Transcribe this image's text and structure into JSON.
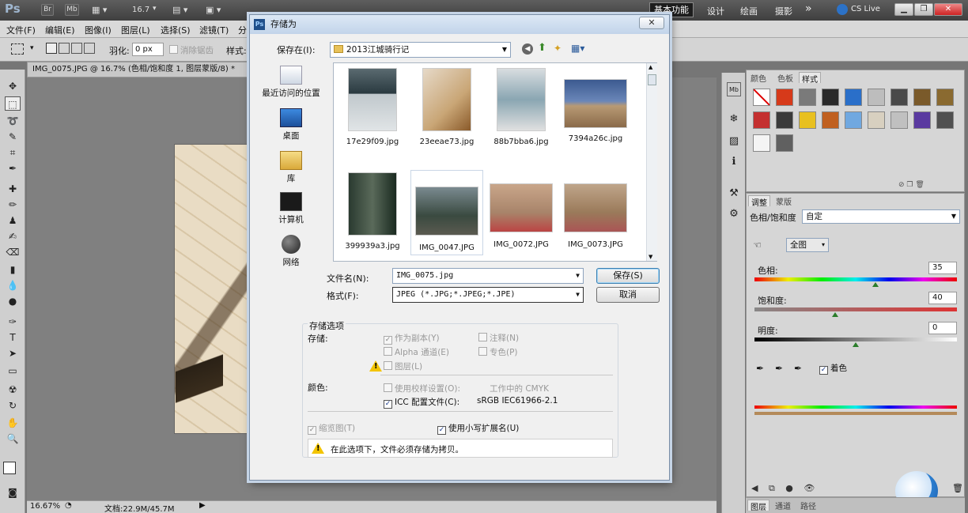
{
  "appbar": {
    "logo": "Ps",
    "br": "Br",
    "mb": "Mb",
    "zoom": "16.7",
    "workspaces": [
      "基本功能",
      "设计",
      "绘画",
      "摄影"
    ],
    "more": "»",
    "cslive": "CS Live"
  },
  "menubar": [
    "文件(F)",
    "编辑(E)",
    "图像(I)",
    "图层(L)",
    "选择(S)",
    "滤镜(T)",
    "分"
  ],
  "options": {
    "feather_label": "羽化:",
    "feather_value": "0 px",
    "antialias": "消除锯齿",
    "style_label": "样式:"
  },
  "document": {
    "tab": "IMG_0075.JPG @ 16.7% (色相/饱和度 1, 图层蒙版/8) *",
    "zoom": "16.67%",
    "docsize": "文档:22.9M/45.7M"
  },
  "styles_panel": {
    "tabs": [
      "颜色",
      "色板",
      "样式"
    ],
    "colors": [
      "#ffffff",
      "#d63a1a",
      "#7a7a7a",
      "#2a2a2a",
      "#2a6fc9",
      "#bdbdbd",
      "#4a4a4a",
      "#7a5a2a",
      "#8a6a30",
      "#c43030",
      "#3a3a3a",
      "#e8c020",
      "#c06020",
      "#70a8e0",
      "#d8d0c0",
      "#c0c0c0",
      "#5a3aa0",
      "#505050",
      "#f4f4f4",
      "#606060"
    ]
  },
  "adjust_panel": {
    "tabs": [
      "调整",
      "蒙版"
    ],
    "preset_label": "色相/饱和度",
    "preset_value": "自定",
    "range": "全图",
    "hue_label": "色相:",
    "hue_value": "35",
    "sat_label": "饱和度:",
    "sat_value": "40",
    "light_label": "明度:",
    "light_value": "0",
    "colorize": "着色"
  },
  "layers_tabs": [
    "图层",
    "通道",
    "路径"
  ],
  "dialog": {
    "title": "存储为",
    "savein_label": "保存在(I):",
    "savein_value": "2013江城骑行记",
    "places": [
      "最近访问的位置",
      "桌面",
      "库",
      "计算机",
      "网络"
    ],
    "files": [
      {
        "name": "17e29f09.jpg"
      },
      {
        "name": "23eeae73.jpg"
      },
      {
        "name": "88b7bba6.jpg"
      },
      {
        "name": "7394a26c.jpg"
      },
      {
        "name": "399939a3.jpg"
      },
      {
        "name": "IMG_0047.JPG"
      },
      {
        "name": "IMG_0072.JPG"
      },
      {
        "name": "IMG_0073.JPG"
      }
    ],
    "filename_label": "文件名(N):",
    "filename_value": "IMG_0075.jpg",
    "format_label": "格式(F):",
    "format_value": "JPEG (*.JPG;*.JPEG;*.JPE)",
    "save_btn": "保存(S)",
    "cancel_btn": "取消",
    "options": {
      "group_title": "存储选项",
      "store_label": "存储:",
      "as_copy": "作为副本(Y)",
      "notes": "注释(N)",
      "alpha": "Alpha 通道(E)",
      "spot": "专色(P)",
      "layers": "图层(L)",
      "color_label": "颜色:",
      "use_proof": "使用校样设置(O):",
      "working_cmyk": "工作中的 CMYK",
      "icc": "ICC 配置文件(C):",
      "icc_value": "sRGB IEC61966-2.1",
      "thumbnail": "缩览图(T)",
      "lowercase": "使用小写扩展名(U)",
      "warning": "在此选项下，文件必须存储为拷贝。"
    }
  }
}
